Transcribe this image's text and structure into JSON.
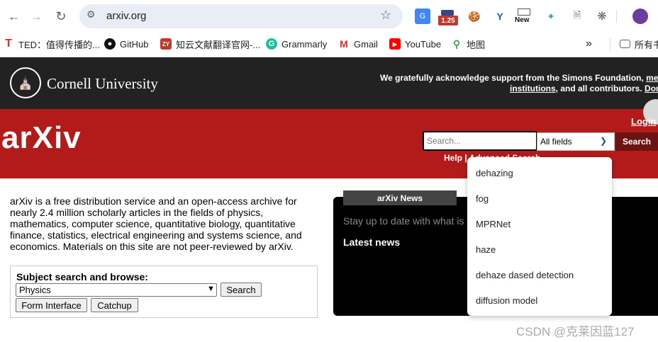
{
  "browser": {
    "url": "arxiv.org",
    "badge": "1.25",
    "ext_new": "New"
  },
  "bookmarks": {
    "items": [
      {
        "label": "TED：值得传播的..."
      },
      {
        "label": "GitHub"
      },
      {
        "label": "知云文献翻译官网-..."
      },
      {
        "label": "Grammarly"
      },
      {
        "label": "Gmail"
      },
      {
        "label": "YouTube"
      },
      {
        "label": "地图"
      }
    ],
    "more": "»",
    "all_folder": "所有书"
  },
  "cornell": {
    "name": "Cornell University",
    "ack_line1": "We gratefully acknowledge support from the Simons Foundation,",
    "ack_link1": "member",
    "ack_link2": "institutions",
    "ack_line2": ", and all contributors.",
    "ack_link3": "Donate"
  },
  "arxiv": {
    "logo": "arXiv",
    "login": "Login",
    "search_placeholder": "Search...",
    "fields_value": "All fields",
    "search_button": "Search",
    "help_text": "Help | Advanced Search"
  },
  "intro": {
    "text": "arXiv is a free distribution service and an open-access archive for nearly 2.4 million scholarly articles in the fields of physics, mathematics, computer science, quantitative biology, quantitative finance, statistics, electrical engineering and systems science, and economics. Materials on this site are not peer-reviewed by arXiv."
  },
  "subject": {
    "title": "Subject search and browse:",
    "selected": "Physics",
    "search_button": "Search",
    "form_button": "Form Interface",
    "catchup_button": "Catchup"
  },
  "news": {
    "tab": "arXiv News",
    "stay": "Stay up to date with what is",
    "latest": "Latest news"
  },
  "autocomplete": {
    "items": [
      "dehazing",
      "fog",
      "MPRNet",
      "haze",
      "dehaze dased detection",
      "diffusion model"
    ]
  },
  "watermark": "CSDN @克莱因蓝127",
  "colors": {
    "arxiv_red": "#b31b1b",
    "cornell_dark": "#222222",
    "search_btn": "#6e1313"
  }
}
